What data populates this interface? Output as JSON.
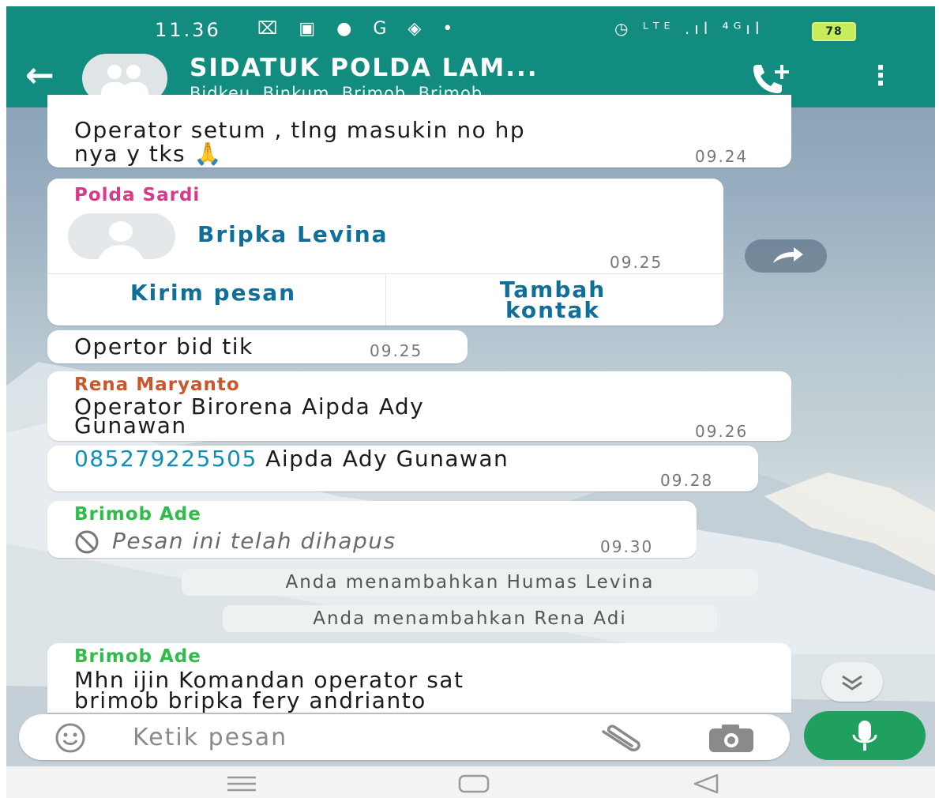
{
  "status_bar": {
    "time": "11.36",
    "icons": "⌧ ▣ ● G ◈ •",
    "right_icons": "◷ ᴸᵀᴱ .ıl ⁴ᴳıl",
    "battery": "78"
  },
  "header": {
    "title": "SIDATUK POLDA LAM...",
    "subtitle": "Bidkeu, Binkum, Brimob, Brimob, ..."
  },
  "messages": {
    "m1": {
      "text_line1": "Operator setum , tlng masukin no hp",
      "text_line2": "nya y tks 🙏",
      "time": "09.24"
    },
    "m2": {
      "sender": "Polda Sardi",
      "contact_name": "Bripka Levina",
      "time": "09.25",
      "action_send": "Kirim pesan",
      "action_add_line1": "Tambah",
      "action_add_line2": "kontak"
    },
    "m3": {
      "text": "Opertor bid tik",
      "time": "09.25"
    },
    "m4": {
      "sender": "Rena Maryanto",
      "text_line1": "Operator Birorena Aipda Ady",
      "text_line2": "Gunawan",
      "time": "09.26"
    },
    "m5": {
      "phone": "085279225505",
      "text": " Aipda Ady Gunawan",
      "time": "09.28"
    },
    "m6": {
      "sender": "Brimob Ade",
      "text": "Pesan ini telah dihapus",
      "time": "09.30"
    },
    "sys1": "Anda menambahkan Humas Levina",
    "sys2": "Anda menambahkan Rena Adi",
    "m7": {
      "sender": "Brimob Ade",
      "text_line1": "Mhn ijin Komandan operator sat",
      "text_line2": "brimob bripka fery andrianto"
    }
  },
  "input": {
    "placeholder": "Ketik pesan"
  },
  "colors": {
    "header": "#128c7e",
    "sender_polda_sardi": "#d63a8c",
    "sender_rena_maryanto": "#c8572b",
    "sender_brimob_ade": "#2fbd4a",
    "link": "#0e6f9a",
    "mic": "#1fa05f"
  },
  "icons": [
    "back-arrow-icon",
    "group-avatar-icon",
    "add-call-icon",
    "more-options-icon",
    "praying-hands-icon",
    "contact-avatar-icon",
    "forward-icon",
    "deleted-icon",
    "scroll-down-icon",
    "emoji-icon",
    "attach-icon",
    "camera-icon",
    "mic-icon",
    "nav-menu-icon",
    "nav-home-icon",
    "nav-back-icon"
  ]
}
